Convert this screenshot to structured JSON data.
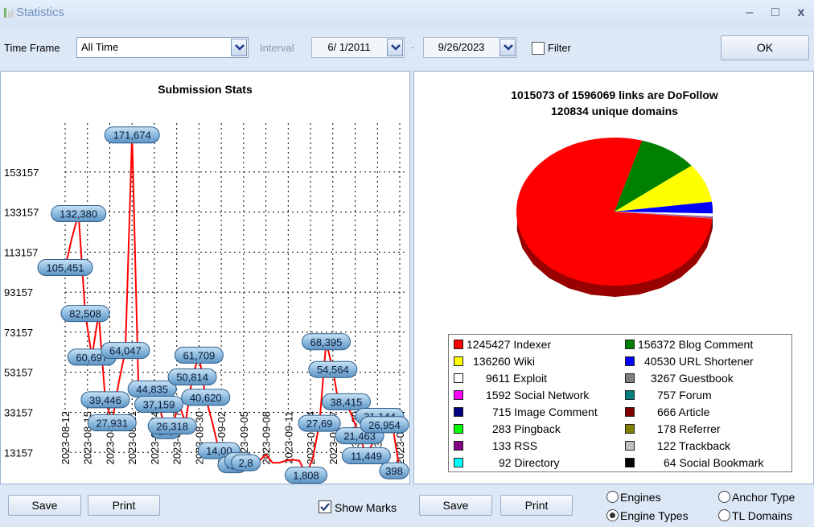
{
  "window": {
    "title": "Statistics",
    "minimize": "–",
    "maximize": "□",
    "close": "x"
  },
  "toolbar": {
    "time_frame_label": "Time Frame",
    "time_frame_value": "All Time",
    "interval_label": "Interval",
    "date_from": "6/ 1/2011",
    "date_sep": "-",
    "date_to": "9/26/2023",
    "filter_label": "Filter",
    "ok_label": "OK"
  },
  "colors": {
    "line": "#ff0000",
    "mark_fill": "#8fbce0",
    "grid": "#000000"
  },
  "chart_data": [
    {
      "type": "line",
      "title": "Submission Stats",
      "yticks": [
        13157,
        33157,
        53157,
        73157,
        93157,
        113157,
        133157,
        153157
      ],
      "ylim": [
        0,
        180000
      ],
      "x_tick_labels": [
        "2023-08-12",
        "2023-08-15",
        "2023-08-18",
        "2023-08-21",
        "2023-08-24",
        "2023-08-27",
        "2023-08-30",
        "2023-09-02",
        "2023-09-05",
        "2023-09-08",
        "2023-09-11",
        "2023-09-14",
        "2023-09-17",
        "2023-09-20",
        "2023-09-23",
        "2023-09-26"
      ],
      "series": [
        {
          "values": [
            105451,
            120000,
            132380,
            82508,
            60697,
            82508,
            39446,
            27931,
            48000,
            64047,
            171674,
            40000,
            48000,
            44835,
            37159,
            24000,
            26318,
            37159,
            28000,
            50814,
            61709,
            40620,
            28000,
            14000,
            10000,
            7000,
            9000,
            8000,
            10000,
            9000,
            12000,
            8000,
            8000,
            9000,
            9500,
            9000,
            1808,
            10000,
            27694,
            68395,
            54564,
            35000,
            38415,
            30000,
            21463,
            11449,
            18000,
            31144,
            26954,
            25000,
            3980
          ]
        }
      ],
      "marks": [
        {
          "label": "171,674",
          "value": 171674
        },
        {
          "label": "132,380",
          "value": 132380
        },
        {
          "label": "105,451",
          "value": 105451
        },
        {
          "label": "82,508",
          "value": 82508
        },
        {
          "label": "60,697",
          "value": 60697
        },
        {
          "label": "64,047",
          "value": 64047
        },
        {
          "label": "39,446",
          "value": 39446
        },
        {
          "label": "27,931",
          "value": 27931
        },
        {
          "label": "44,835",
          "value": 44835
        },
        {
          "label": "37,159",
          "value": 37159
        },
        {
          "label": "24,",
          "value": 24000
        },
        {
          "label": "26,318",
          "value": 26318
        },
        {
          "label": "61,709",
          "value": 61709
        },
        {
          "label": "50,814",
          "value": 50814
        },
        {
          "label": "40,620",
          "value": 40620
        },
        {
          "label": "14,00",
          "value": 14000
        },
        {
          "label": "7,2",
          "value": 7000
        },
        {
          "label": "2,7",
          "value": 9000
        },
        {
          "label": "2,8",
          "value": 8000
        },
        {
          "label": "1,808",
          "value": 1808
        },
        {
          "label": "68,395",
          "value": 68395
        },
        {
          "label": "54,564",
          "value": 54564
        },
        {
          "label": "27,69",
          "value": 27694
        },
        {
          "label": "38,415",
          "value": 38415
        },
        {
          "label": "21,463",
          "value": 21463
        },
        {
          "label": "11,449",
          "value": 11449
        },
        {
          "label": "31,144",
          "value": 31144
        },
        {
          "label": "26,954",
          "value": 26954
        },
        {
          "label": "398",
          "value": 3980
        }
      ]
    },
    {
      "type": "pie",
      "title": "1015073 of 1596069 links are DoFollow",
      "subtitle": "120834 unique domains",
      "slices": [
        {
          "label": "Indexer",
          "value": 1245427,
          "color": "#ff0000"
        },
        {
          "label": "Blog Comment",
          "value": 156372,
          "color": "#008000"
        },
        {
          "label": "Wiki",
          "value": 136260,
          "color": "#ffff00"
        },
        {
          "label": "URL Shortener",
          "value": 40530,
          "color": "#0000ff"
        },
        {
          "label": "Exploit",
          "value": 9611,
          "color": "#ffffff"
        },
        {
          "label": "Guestbook",
          "value": 3267,
          "color": "#808080"
        },
        {
          "label": "Social Network",
          "value": 1592,
          "color": "#ff00ff"
        },
        {
          "label": "Forum",
          "value": 757,
          "color": "#008080"
        },
        {
          "label": "Image Comment",
          "value": 715,
          "color": "#000080"
        },
        {
          "label": "Article",
          "value": 666,
          "color": "#800000"
        },
        {
          "label": "Pingback",
          "value": 283,
          "color": "#00ff00"
        },
        {
          "label": "Referrer",
          "value": 178,
          "color": "#808000"
        },
        {
          "label": "RSS",
          "value": 133,
          "color": "#800080"
        },
        {
          "label": "Trackback",
          "value": 122,
          "color": "#c0c0c0"
        },
        {
          "label": "Directory",
          "value": 92,
          "color": "#00ffff"
        },
        {
          "label": "Social Bookmark",
          "value": 64,
          "color": "#000000"
        }
      ]
    }
  ],
  "legend": [
    {
      "count": "1245427",
      "name": "Indexer",
      "color": "#ff0000"
    },
    {
      "count": "156372",
      "name": "Blog Comment",
      "color": "#008000"
    },
    {
      "count": "136260",
      "name": "Wiki",
      "color": "#ffff00"
    },
    {
      "count": "40530",
      "name": "URL Shortener",
      "color": "#0000ff"
    },
    {
      "count": "9611",
      "name": "Exploit",
      "color": "#ffffff"
    },
    {
      "count": "3267",
      "name": "Guestbook",
      "color": "#808080"
    },
    {
      "count": "1592",
      "name": "Social Network",
      "color": "#ff00ff"
    },
    {
      "count": "757",
      "name": "Forum",
      "color": "#008080"
    },
    {
      "count": "715",
      "name": "Image Comment",
      "color": "#000080"
    },
    {
      "count": "666",
      "name": "Article",
      "color": "#800000"
    },
    {
      "count": "283",
      "name": "Pingback",
      "color": "#00ff00"
    },
    {
      "count": "178",
      "name": "Referrer",
      "color": "#808000"
    },
    {
      "count": "133",
      "name": "RSS",
      "color": "#800080"
    },
    {
      "count": "122",
      "name": "Trackback",
      "color": "#c0c0c0"
    },
    {
      "count": "92",
      "name": "Directory",
      "color": "#00ffff"
    },
    {
      "count": "64",
      "name": "Social Bookmark",
      "color": "#000000"
    }
  ],
  "bottom": {
    "save_left": "Save",
    "print_left": "Print",
    "show_marks_label": "Show Marks",
    "save_right": "Save",
    "print_right": "Print",
    "radio_engines": "Engines",
    "radio_engine_types": "Engine Types",
    "radio_anchor_type": "Anchor Type",
    "radio_tl_domains": "TL Domains"
  }
}
